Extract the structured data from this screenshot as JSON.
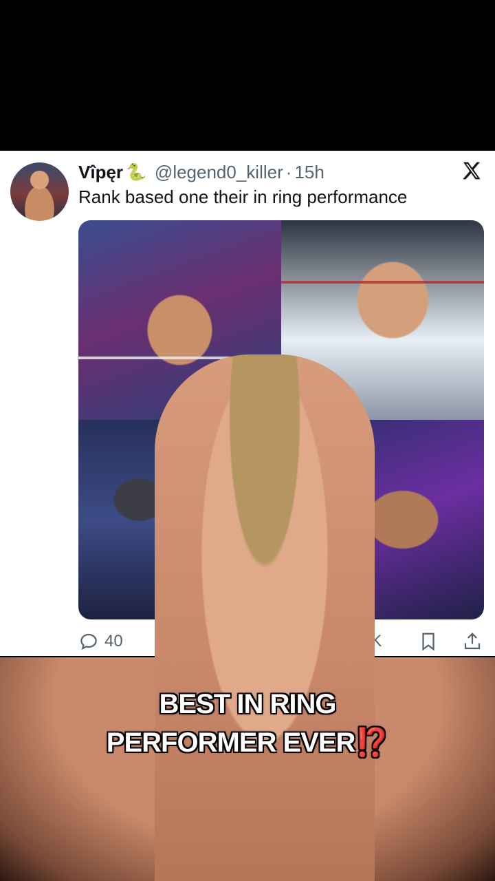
{
  "tweet": {
    "display_name": "Vîpęr",
    "name_emoji": "🐍",
    "handle": "@legend0_killer",
    "separator": "·",
    "time": "15h",
    "text": "Rank based one their in ring performance"
  },
  "actions": {
    "replies": "40",
    "views": "3.5K"
  },
  "caption": {
    "line1": "BEST IN RING",
    "line2": "PERFORMER EVER",
    "emoji": "⁉️"
  },
  "icons": {
    "platform": "x-logo-icon",
    "reply": "comment-icon",
    "retweet": "retweet-icon",
    "bookmark": "bookmark-icon",
    "share": "share-icon"
  }
}
